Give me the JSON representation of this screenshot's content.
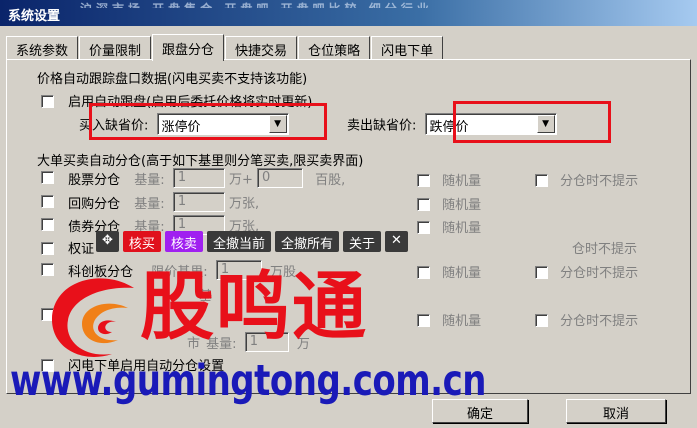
{
  "window": {
    "title": "系统设置",
    "ghost_text": "沪深市场  开盘集合  开盘吧  开盘吧比较  细分行业"
  },
  "tabs": [
    "系统参数",
    "价量限制",
    "跟盘分仓",
    "快捷交易",
    "仓位策略",
    "闪电下单"
  ],
  "active_tab": 2,
  "follow": {
    "section_label": "价格自动跟踪盘口数据(闪电买卖不支持该功能)",
    "enable_label": "启用自动跟盘(启用后委托价格将实时更新)",
    "buy_label": "买入缺省价:",
    "buy_value": "涨停价",
    "sell_label": "卖出缺省价:",
    "sell_value": "跌停价"
  },
  "split": {
    "section_label": "大单买卖自动分仓(高于如下基里则分笔买卖,限买卖界面)",
    "base_label": "基量:",
    "limit_base_label": "限价基里:",
    "random_label": "随机量",
    "no_prompt_label": "分仓时不提示",
    "rows": [
      {
        "label": "股票分仓",
        "value": "1",
        "unit": "万+",
        "value2": "0",
        "unit2": "百股,"
      },
      {
        "label": "回购分仓",
        "value": "1",
        "unit": "万张,"
      },
      {
        "label": "债券分仓",
        "value": "1",
        "unit": "万张,"
      },
      {
        "label": "权证",
        "partial_text": "仓时不提示"
      },
      {
        "label": "科创板分仓",
        "value": "1",
        "unit": "万股,"
      }
    ],
    "row6_value": "1",
    "row7_value": "1",
    "partial_words": {
      "base": "基",
      "market": "市",
      "base2": "基量:",
      "wan": "万"
    },
    "flash_label": "闪电下单启用自动分仓设置"
  },
  "toolbar": {
    "move": "✥",
    "check_buy": "核买",
    "check_sell": "核卖",
    "cancel_current": "全撤当前",
    "cancel_all": "全撤所有",
    "about": "关于",
    "close": "✕"
  },
  "footer": {
    "ok": "确定",
    "cancel": "取消"
  },
  "watermark": {
    "brand": "股鸣通",
    "url": "www.gumingtong.com.cn"
  },
  "colors": {
    "highlight": "#e8101a",
    "brand_red": "#e8101a",
    "brand_blue": "#1a1ab8",
    "accent_purple": "#a020f0"
  }
}
